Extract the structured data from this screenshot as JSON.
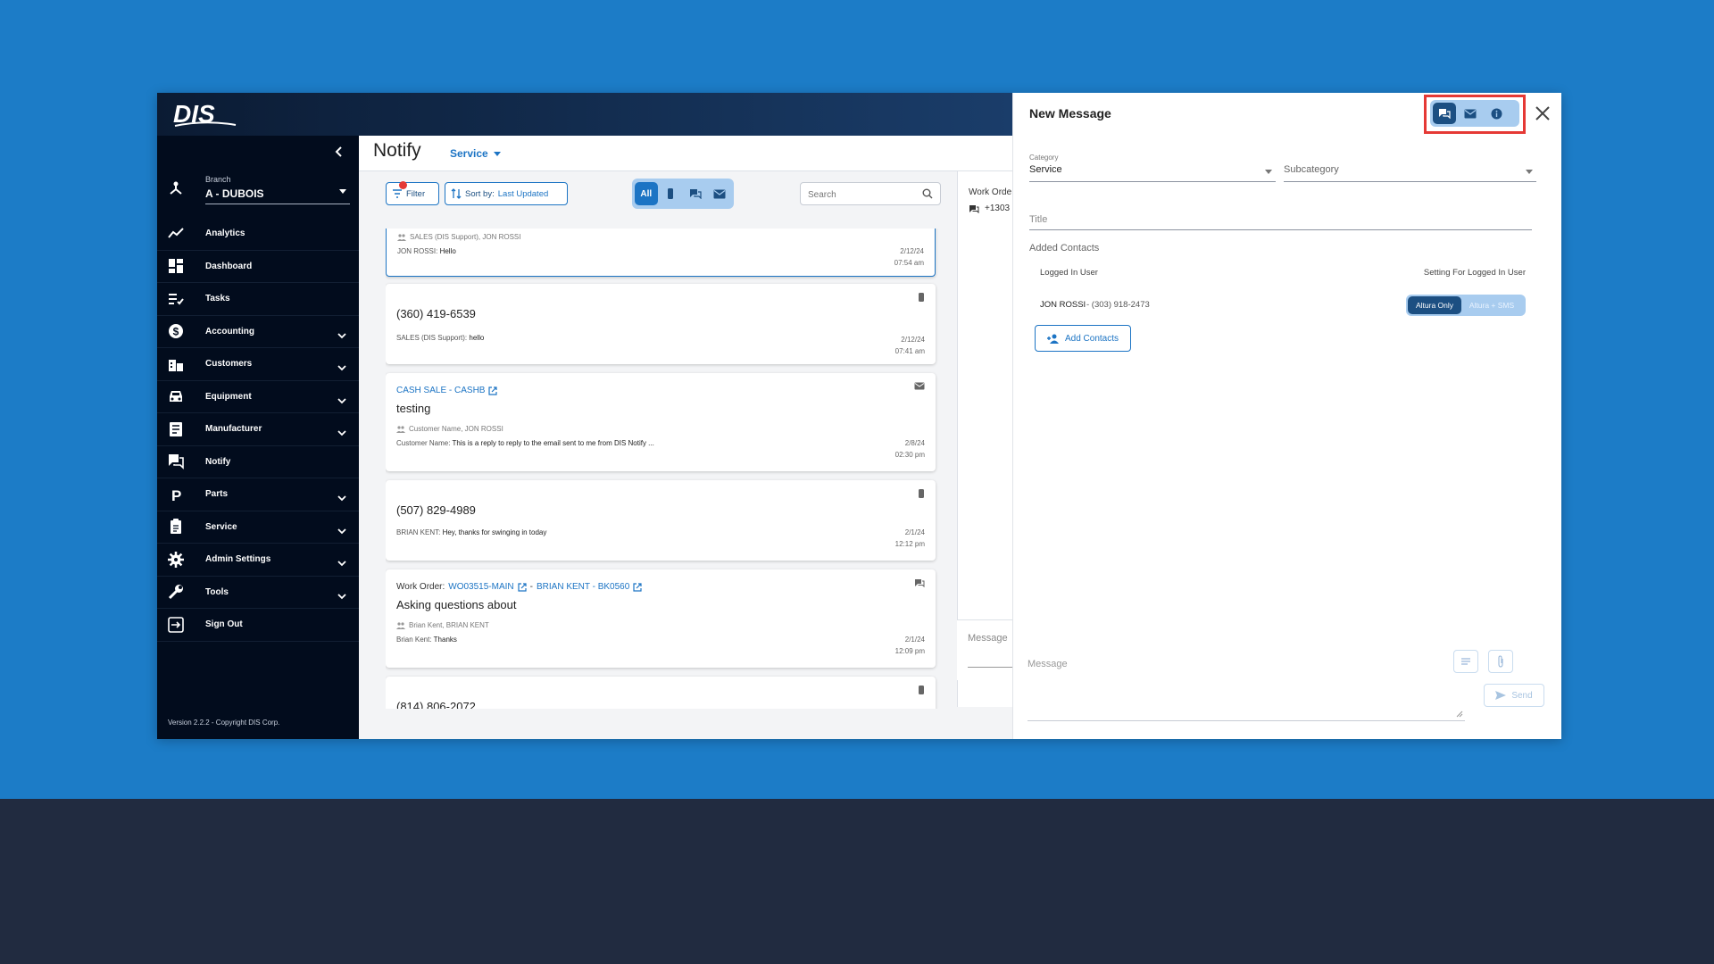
{
  "app": {
    "logo_text": "DIS",
    "version": "Version 2.2.2 - Copyright DIS Corp."
  },
  "sidebar": {
    "branch_label": "Branch",
    "branch_value": "A - DUBOIS",
    "items": [
      {
        "label": "Analytics",
        "icon": "analytics-icon",
        "expandable": false
      },
      {
        "label": "Dashboard",
        "icon": "dashboard-icon",
        "expandable": false
      },
      {
        "label": "Tasks",
        "icon": "tasks-icon",
        "expandable": false
      },
      {
        "label": "Accounting",
        "icon": "dollar-icon",
        "expandable": true
      },
      {
        "label": "Customers",
        "icon": "customers-icon",
        "expandable": true
      },
      {
        "label": "Equipment",
        "icon": "car-icon",
        "expandable": true
      },
      {
        "label": "Manufacturer",
        "icon": "manufacturer-icon",
        "expandable": true
      },
      {
        "label": "Notify",
        "icon": "chat-icon",
        "expandable": false
      },
      {
        "label": "Parts",
        "icon": "parts-icon",
        "expandable": true
      },
      {
        "label": "Service",
        "icon": "clipboard-icon",
        "expandable": true
      },
      {
        "label": "Admin Settings",
        "icon": "gear-icon",
        "expandable": true
      },
      {
        "label": "Tools",
        "icon": "wrench-icon",
        "expandable": true
      },
      {
        "label": "Sign Out",
        "icon": "sign-out-icon",
        "expandable": false
      }
    ]
  },
  "header": {
    "title": "Notify",
    "dropdown": "Service"
  },
  "toolbar": {
    "filter_label": "Filter",
    "sort_prefix": "Sort by:",
    "sort_value": "Last Updated",
    "type_all": "All",
    "search_placeholder": "Search"
  },
  "conversations": [
    {
      "participants": "SALES (DIS Support), JON ROSSI",
      "sender": "JON ROSSI:",
      "message": "Hello",
      "date": "2/12/24",
      "time": "07:54 am"
    },
    {
      "title": "(360) 419-6539",
      "sender": "SALES (DIS Support):",
      "message": "hello",
      "date": "2/12/24",
      "time": "07:41 am",
      "type_icon": "sms-icon"
    },
    {
      "link": "CASH SALE - CASHB",
      "title": "testing",
      "participants": "Customer Name, JON ROSSI",
      "sender": "Customer Name:",
      "message": "This is a reply to reply to the email sent to me from DIS Notify ...",
      "date": "2/8/24",
      "time": "02:30 pm",
      "type_icon": "email-icon"
    },
    {
      "title": "(507) 829-4989",
      "sender": "BRIAN KENT:",
      "message": "Hey, thanks for swinging in today",
      "date": "2/1/24",
      "time": "12:12 pm",
      "type_icon": "sms-icon"
    },
    {
      "wo_prefix": "Work Order:",
      "wo_link": "WO03515-MAIN",
      "separator": "-",
      "cust_link": "BRIAN KENT - BK0560",
      "title": "Asking questions about",
      "participants": "Brian Kent, BRIAN KENT",
      "sender": "Brian Kent:",
      "message": "Thanks",
      "date": "2/1/24",
      "time": "12:09 pm",
      "type_icon": "chat-icon"
    },
    {
      "title": "(814) 806-2072",
      "type_icon": "sms-icon"
    }
  ],
  "detail": {
    "work_order": "Work Orde",
    "phone": "+1303",
    "message_placeholder": "Message"
  },
  "new_message": {
    "title": "New Message",
    "category_label": "Category",
    "category_value": "Service",
    "subcategory_placeholder": "Subcategory",
    "title_placeholder": "Title",
    "added_contacts": "Added Contacts",
    "logged_in_user": "Logged In User",
    "setting_label": "Setting For Logged In User",
    "contact_name": "JON ROSSI",
    "contact_phone": "- (303) 918-2473",
    "seg_active": "Altura Only",
    "seg_inactive": "Altura + SMS",
    "add_contacts": "Add Contacts",
    "message_placeholder": "Message",
    "send": "Send"
  },
  "colors": {
    "background": "#1c7cc7",
    "band": "#212b40",
    "sidebar": "#020c1d",
    "accent": "#1c74c4",
    "highlight_box": "#e53935"
  }
}
